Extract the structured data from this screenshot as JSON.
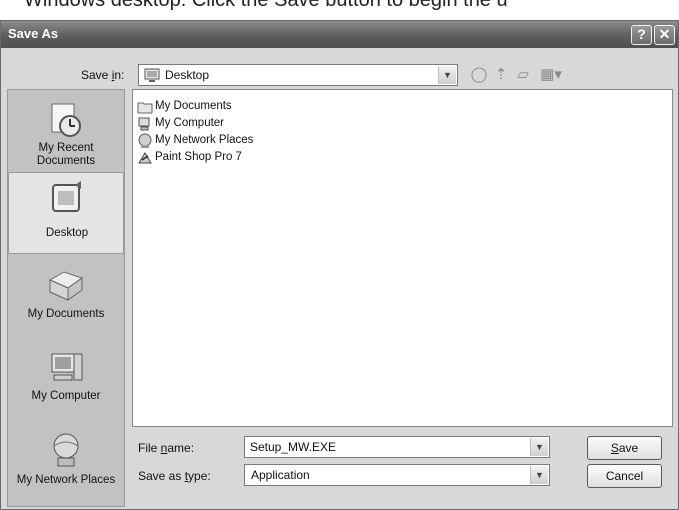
{
  "caption": "Windows desktop. Click the Save button to begin the u",
  "window": {
    "title": "Save As",
    "help_label": "?",
    "close_label": "✕"
  },
  "save_in": {
    "label_pre": "Save ",
    "label_key": "i",
    "label_post": "n:",
    "value": "Desktop"
  },
  "places": [
    {
      "name": "my-recent-documents",
      "label": "My Recent Documents",
      "icon": "recent-documents-icon"
    },
    {
      "name": "desktop",
      "label": "Desktop",
      "icon": "desktop-icon"
    },
    {
      "name": "my-documents",
      "label": "My Documents",
      "icon": "my-documents-icon"
    },
    {
      "name": "my-computer",
      "label": "My Computer",
      "icon": "my-computer-icon"
    },
    {
      "name": "my-network-places",
      "label": "My Network Places",
      "icon": "network-places-icon"
    }
  ],
  "files": [
    {
      "label": "My Documents",
      "icon": "folder-icon"
    },
    {
      "label": "My Computer",
      "icon": "computer-icon"
    },
    {
      "label": "My Network Places",
      "icon": "network-icon"
    },
    {
      "label": "Paint Shop Pro 7",
      "icon": "shortcut-icon"
    }
  ],
  "file_name": {
    "label_pre": "File ",
    "label_key": "n",
    "label_post": "ame:",
    "value": "Setup_MW.EXE"
  },
  "save_as_type": {
    "label_pre": "Save as ",
    "label_key": "t",
    "label_post": "ype:",
    "value": "Application"
  },
  "buttons": {
    "save_key": "S",
    "save_rest": "ave",
    "cancel": "Cancel"
  },
  "colors": {
    "titlebar": "#5e5e5e",
    "dialog_bg": "#d8d8d8",
    "places_bg": "#c2c2c2"
  }
}
